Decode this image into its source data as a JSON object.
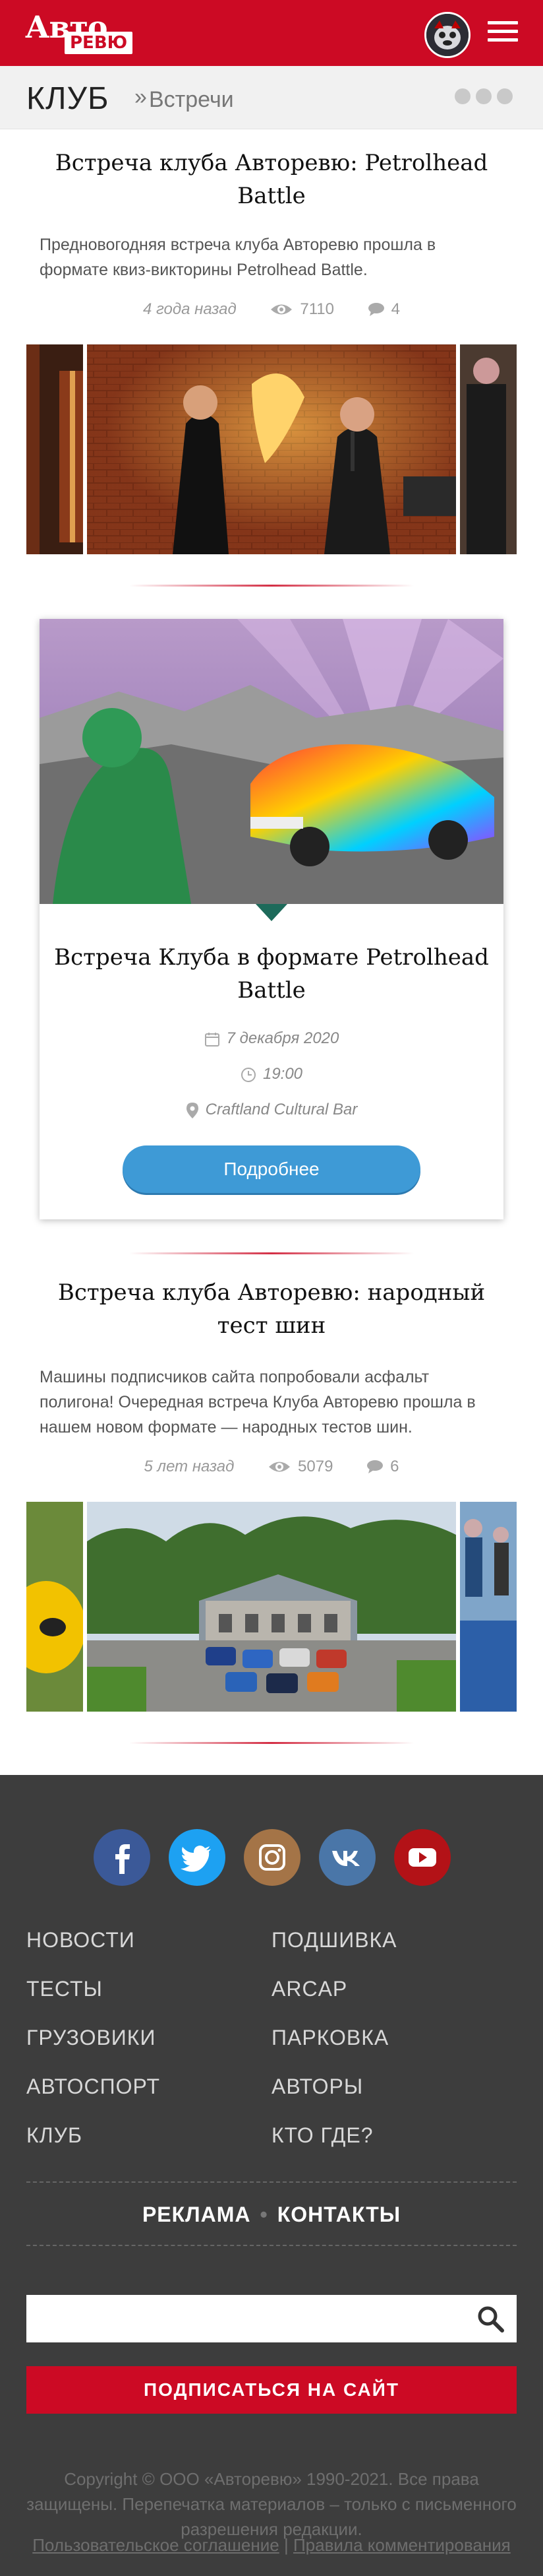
{
  "header": {
    "logo_top": "Авто",
    "logo_bottom": "РЕВЮ"
  },
  "breadcrumb": {
    "section": "КЛУБ",
    "separator": "»",
    "page": "Встречи"
  },
  "articles": [
    {
      "title": "Встреча клуба Авторевю: Petrolhead Battle",
      "text": "Предновогодняя встреча клуба Авторевю прошла в формате квиз-викторины Petrolhead Battle.",
      "ago": "4 года назад",
      "views": "7110",
      "comments": "4"
    },
    {
      "title": "Встреча клуба Авторевю: народный тест шин",
      "text": "Машины подписчиков сайта попробовали асфальт полигона! Очередная встреча Клуба Авторевю прошла в нашем новом формате — народных тестов шин.",
      "ago": "5 лет назад",
      "views": "5079",
      "comments": "6"
    }
  ],
  "event": {
    "title": "Встреча Клуба в формате Petrolhead Battle",
    "date": "7 декабря 2020",
    "time": "19:00",
    "place": "Craftland Cultural Bar",
    "button": "Подробнее"
  },
  "footer": {
    "social": [
      "facebook",
      "twitter",
      "instagram",
      "vk",
      "youtube"
    ],
    "social_colors": [
      "#3b5998",
      "#1da1f2",
      "#a47447",
      "#4a76a8",
      "#b31217"
    ],
    "nav_left": [
      "НОВОСТИ",
      "ТЕСТЫ",
      "ГРУЗОВИКИ",
      "АВТОСПОРТ",
      "КЛУБ"
    ],
    "nav_right": [
      "ПОДШИВКА",
      "ARCAP",
      "ПАРКОВКА",
      "АВТОРЫ",
      "КТО ГДЕ?"
    ],
    "link_ads": "РЕКЛАМА",
    "link_sep": "•",
    "link_contacts": "КОНТАКТЫ",
    "search_placeholder": "",
    "subscribe": "ПОДПИСАТЬСЯ НА САЙТ",
    "copyright": "Copyright © ООО «Авторевю» 1990-2021. Все права защищены. Перепечатка материалов – только с письменного разрешения редакции.",
    "agreement": "Пользовательское соглашение",
    "legal_sep": "|",
    "rules": "Правила комментирования"
  },
  "colors": {
    "brand": "#cc0a24",
    "button": "#3e9ad6",
    "footer_bg": "#3d3d3d"
  }
}
